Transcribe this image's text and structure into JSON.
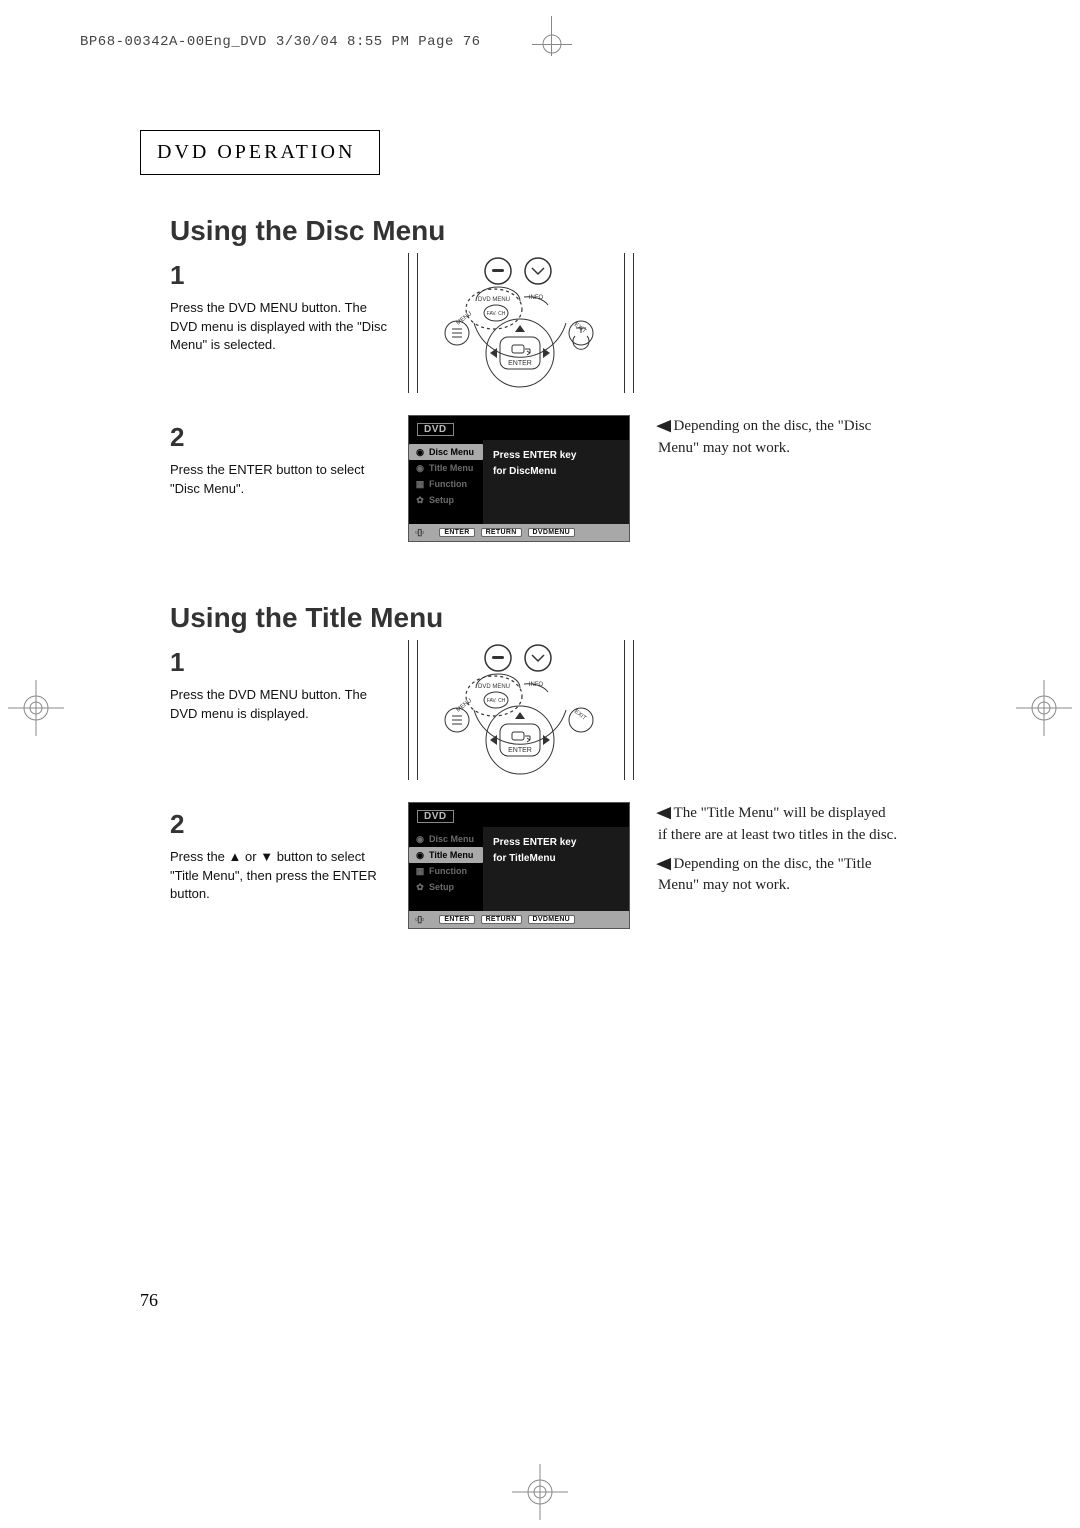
{
  "print_header": "BP68-00342A-00Eng_DVD  3/30/04  8:55 PM  Page 76",
  "section_label": "DVD OPERATION",
  "page_number": "76",
  "section1": {
    "heading": "Using the Disc Menu",
    "step1_num": "1",
    "step1_text": "Press the DVD MENU button. The DVD menu is displayed with the \"Disc Menu\" is selected.",
    "step2_num": "2",
    "step2_text": "Press the ENTER button to select \"Disc Menu\".",
    "osd_dvd": "DVD",
    "osd_items": [
      "Disc Menu",
      "Title Menu",
      "Function",
      "Setup"
    ],
    "osd_selected_index": 0,
    "osd_main_l1": "Press ENTER key",
    "osd_main_l2": "for DiscMenu",
    "osd_foot": [
      "ENTER",
      "RETURN",
      "DVDMENU"
    ],
    "note1": "Depending on the disc, the \"Disc Menu\" may not work."
  },
  "section2": {
    "heading": "Using the Title Menu",
    "step1_num": "1",
    "step1_text": "Press the DVD MENU button. The DVD menu is displayed.",
    "step2_num": "2",
    "step2_text_a": "Press the ",
    "step2_text_b": " or ",
    "step2_text_c": " button to select \"Title Menu\", then press the ENTER button.",
    "osd_dvd": "DVD",
    "osd_items": [
      "Disc Menu",
      "Title Menu",
      "Function",
      "Setup"
    ],
    "osd_selected_index": 1,
    "osd_main_l1": "Press ENTER key",
    "osd_main_l2": "for TitleMenu",
    "osd_foot": [
      "ENTER",
      "RETURN",
      "DVDMENU"
    ],
    "note1": "The \"Title Menu\" will be displayed if there are at least two titles in the disc.",
    "note2": "Depending on the disc, the \"Title Menu\" may not work."
  },
  "remote_labels": {
    "dvd_menu": "DVD MENU",
    "info": "INFO",
    "menu": "MENU",
    "exit": "EXIT",
    "fav_ch": "FAV. CH",
    "enter": "ENTER"
  }
}
